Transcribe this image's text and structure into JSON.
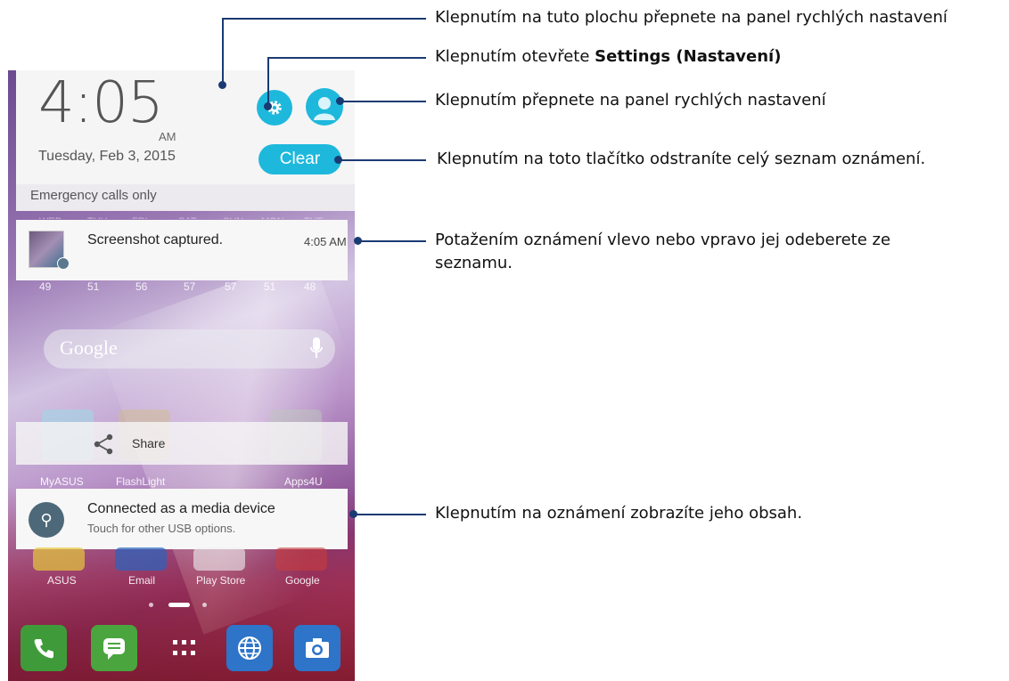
{
  "phone": {
    "time": "4:05",
    "ampm": "AM",
    "date": "Tuesday, Feb 3, 2015",
    "clear_label": "Clear",
    "emergency": "Emergency calls only",
    "weekdays": [
      "WED",
      "THU",
      "FRI",
      "SAT",
      "SUN",
      "MON",
      "TUE"
    ],
    "temps": [
      "49",
      "51",
      "56",
      "57",
      "57",
      "51",
      "48"
    ],
    "screenshot_notification": {
      "title": "Screenshot captured.",
      "time": "4:05 AM"
    },
    "search_logo": "Google",
    "share_label": "Share",
    "apps_row1": [
      "MyASUS",
      "FlashLight",
      "Apps4U"
    ],
    "usb_notification": {
      "title": "Connected as a media device",
      "subtitle": "Touch for other USB options."
    },
    "apps_row2": [
      "ASUS",
      "Email",
      "Play Store",
      "Google"
    ],
    "colors": {
      "accent": "#1eb8dc",
      "callout": "#1a3a72"
    }
  },
  "callouts": {
    "quick_settings_area": "Klepnutím na tuto plochu přepnete na panel rychlých nastavení",
    "settings_prefix": "Klepnutím otevřete ",
    "settings_bold": "Settings (Nastavení)",
    "profile": "Klepnutím přepnete na panel rychlých nastavení",
    "clear": "Klepnutím na toto tlačítko odstraníte celý seznam oznámení.",
    "swipe_line1": "Potažením oznámení vlevo nebo vpravo jej odeberete ze",
    "swipe_line2": "seznamu.",
    "tap_notification": "Klepnutím na oznámení zobrazíte jeho obsah."
  }
}
